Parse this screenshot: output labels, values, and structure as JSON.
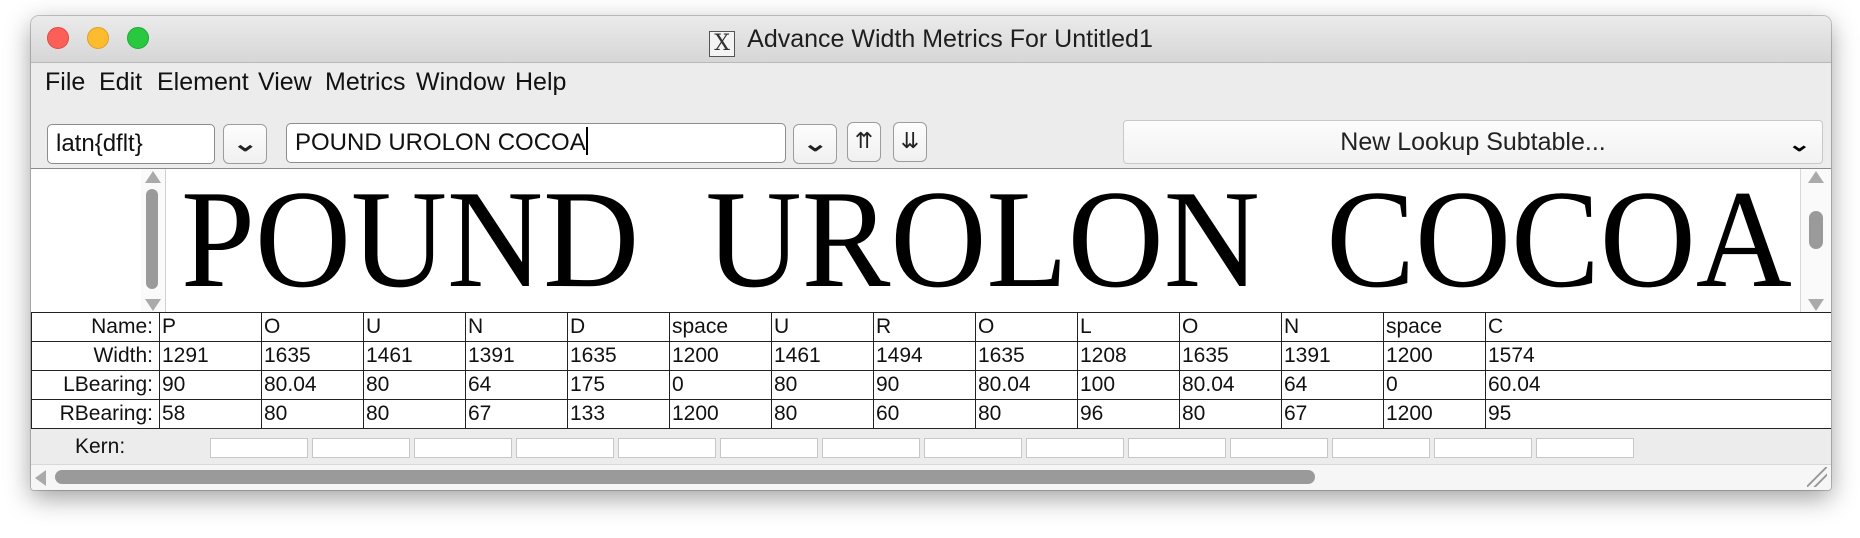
{
  "window": {
    "title": "Advance Width Metrics For Untitled1",
    "title_icon": "x11-icon"
  },
  "menu": [
    "File",
    "Edit",
    "Element",
    "View",
    "Metrics",
    "Window",
    "Help"
  ],
  "toolbar": {
    "script_value": "latn{dflt}",
    "text_value": "POUND UROLON COCOA",
    "lookup_label": "New Lookup Subtable..."
  },
  "preview": {
    "text": "POUND  UROLON  COCOA"
  },
  "metrics": {
    "row_labels": {
      "name": "Name:",
      "width": "Width:",
      "lbearing": "LBearing:",
      "rbearing": "RBearing:",
      "kern": "Kern:"
    },
    "glyphs": [
      {
        "name": "P",
        "width": "1291",
        "lbearing": "90",
        "rbearing": "58"
      },
      {
        "name": "O",
        "width": "1635",
        "lbearing": "80.04",
        "rbearing": "80"
      },
      {
        "name": "U",
        "width": "1461",
        "lbearing": "80",
        "rbearing": "80"
      },
      {
        "name": "N",
        "width": "1391",
        "lbearing": "64",
        "rbearing": "67"
      },
      {
        "name": "D",
        "width": "1635",
        "lbearing": "175",
        "rbearing": "133"
      },
      {
        "name": "space",
        "width": "1200",
        "lbearing": "0",
        "rbearing": "1200"
      },
      {
        "name": "U",
        "width": "1461",
        "lbearing": "80",
        "rbearing": "80"
      },
      {
        "name": "R",
        "width": "1494",
        "lbearing": "90",
        "rbearing": "60"
      },
      {
        "name": "O",
        "width": "1635",
        "lbearing": "80.04",
        "rbearing": "80"
      },
      {
        "name": "L",
        "width": "1208",
        "lbearing": "100",
        "rbearing": "96"
      },
      {
        "name": "O",
        "width": "1635",
        "lbearing": "80.04",
        "rbearing": "80"
      },
      {
        "name": "N",
        "width": "1391",
        "lbearing": "64",
        "rbearing": "67"
      },
      {
        "name": "space",
        "width": "1200",
        "lbearing": "0",
        "rbearing": "1200"
      },
      {
        "name": "C",
        "width": "1574",
        "lbearing": "60.04",
        "rbearing": "95"
      }
    ]
  }
}
